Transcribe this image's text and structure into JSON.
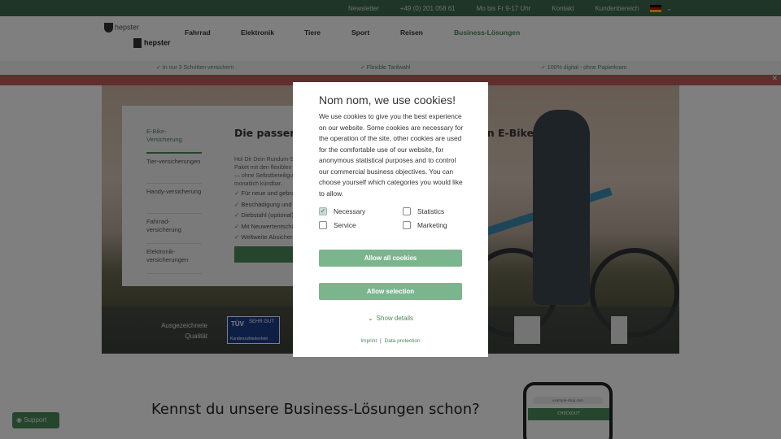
{
  "topbar": {
    "items": [
      "Newsletter",
      "+49 (0) 201 058 61",
      "Mo bis Fr 9-17 Uhr",
      "Kontakt",
      "Kundenbereich"
    ],
    "flag": "german-flag",
    "chevron": "chevron-down-icon"
  },
  "header": {
    "logo_primary": "hepster",
    "logo_secondary": "hepster",
    "nav": [
      "Fahrrad",
      "Elektronik",
      "Tiere",
      "Sport",
      "Reisen",
      "Business-Lösungen"
    ]
  },
  "usp": [
    "✓ In nur 3 Schritten versichern",
    "✓ Flexible Tarifwahl",
    "✓ 100% digital - ohne Papierkram"
  ],
  "hero": {
    "tabs": [
      "E-Bike-Versicherung",
      "Tier-versicherungen",
      "Handy-versicherung",
      "Fahrrad-versicherung",
      "Elektronik-versicherungen"
    ],
    "title": "Die passende Versicherung für Dich und Dein E-Bike",
    "text": "Hol Dir Dein Rundum-Sorglos-Paket mit den flexiblen Tarifen — ohne Selbstbeteiligung und monatlich kündbar.",
    "bullets": [
      "Für neue und gebrauchte E-Bikes",
      "Beschädigung und Unfall",
      "Diebstahl (optional)",
      "Mit Neuwertentschädigung",
      "Weltweite Absicherung"
    ],
    "quality_label": "Ausgezeichnete Qualität",
    "tuv_text": "SEHR GUT",
    "tuv_sub": "Kundenzufriedenheit"
  },
  "bottom": {
    "title": "Kennst du unsere Business-Lösungen schon?",
    "phone_url": "example-shop.com",
    "phone_bar": "CHECKOUT"
  },
  "support": "Support",
  "cookie": {
    "title": "Nom nom, we use cookies!",
    "description": "We use cookies to give you the best experience on our website. Some cookies are necessary for the operation of the site, other cookies are used for the comfortable use of our website, for anonymous statistical purposes and to control our commercial business objectives. You can choose yourself which categories you would like to allow.",
    "options": [
      {
        "label": "Necessary",
        "checked": true
      },
      {
        "label": "Statistics",
        "checked": false
      },
      {
        "label": "Service",
        "checked": false
      },
      {
        "label": "Marketing",
        "checked": false
      }
    ],
    "allow_all": "Allow all cookies",
    "allow_selection": "Allow selection",
    "show_details": "Show details",
    "imprint": "Imprint",
    "separator": "|",
    "data_protection": "Data protection"
  },
  "colors": {
    "brand_green": "#4a8a5a",
    "button_green": "#7bb58e",
    "topbar": "#3e6b4f",
    "promo": "#c25a5a"
  }
}
